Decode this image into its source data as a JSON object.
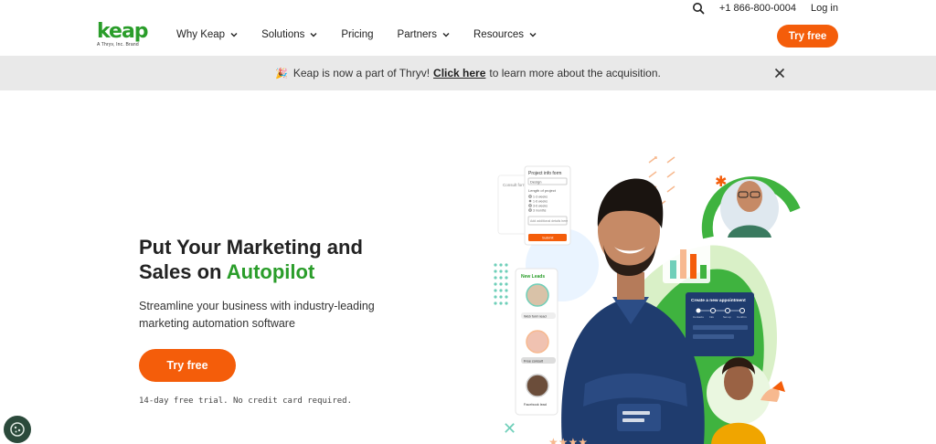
{
  "topbar": {
    "phone": "+1 866-800-0004",
    "login": "Log in"
  },
  "brand": {
    "name": "keap",
    "tagline": "A Thryv, Inc. Brand",
    "color": "#2a9d2a"
  },
  "nav": {
    "items": [
      {
        "label": "Why Keap",
        "dropdown": true
      },
      {
        "label": "Solutions",
        "dropdown": true
      },
      {
        "label": "Pricing",
        "dropdown": false
      },
      {
        "label": "Partners",
        "dropdown": true
      },
      {
        "label": "Resources",
        "dropdown": true
      }
    ],
    "cta": "Try free"
  },
  "banner": {
    "emoji": "🎉",
    "text_before": "Keap is now a part of Thryv!",
    "link": "Click here",
    "text_after": "to learn more about the acquisition."
  },
  "hero": {
    "title_line1": "Put Your Marketing and",
    "title_line2_prefix": "Sales on ",
    "title_accent": "Autopilot",
    "subtitle": "Streamline your business with industry-leading marketing automation software",
    "cta": "Try free",
    "fine_print": "14-day free trial. No credit card required."
  },
  "graphic": {
    "form_title": "Project info form",
    "form_select": "Design",
    "form_label": "Length of project",
    "form_options": [
      "1-3 weeks",
      "1-6 weeks",
      "3-6 weeks",
      "3 months"
    ],
    "form_input": "Add additional details here",
    "form_submit": "Submit",
    "ghost_card": "Consult form",
    "leads_title": "New Leads",
    "lead_tags": [
      "Web form lead",
      "Free consult",
      "Facebook lead"
    ],
    "appointment_title": "Create a new appointment",
    "appointment_steps": [
      "Contacts",
      "Info",
      "Set up",
      "Confirm"
    ]
  },
  "colors": {
    "accent": "#f45d0a",
    "green": "#2a9d2a",
    "banner_bg": "#e9e9e9",
    "cookie_bg": "#2b4a3b"
  },
  "icons": {
    "search": "search-icon",
    "close": "close-icon",
    "chevron": "chevron-down-icon",
    "cookie": "cookie-icon"
  }
}
